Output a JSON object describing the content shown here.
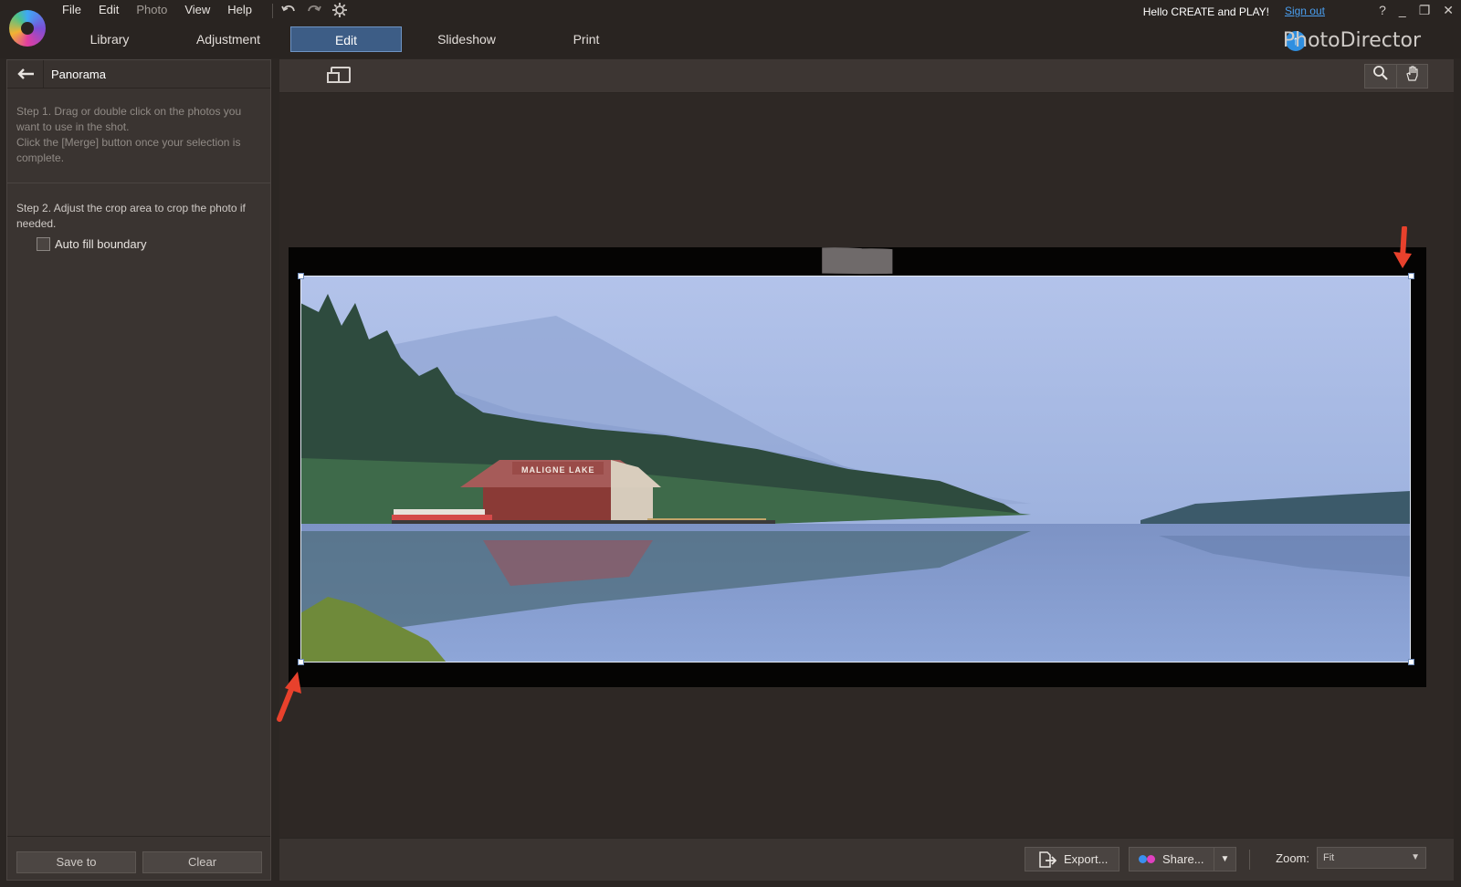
{
  "menu": {
    "items": [
      {
        "label": "File",
        "enabled": true
      },
      {
        "label": "Edit",
        "enabled": true
      },
      {
        "label": "Photo",
        "enabled": false
      },
      {
        "label": "View",
        "enabled": true
      },
      {
        "label": "Help",
        "enabled": true
      }
    ]
  },
  "toolbar_icons": [
    "undo-icon",
    "redo-icon",
    "settings-icon"
  ],
  "tabs": [
    {
      "label": "Library",
      "active": false
    },
    {
      "label": "Adjustment",
      "active": false
    },
    {
      "label": "Edit",
      "active": true
    },
    {
      "label": "Slideshow",
      "active": false
    },
    {
      "label": "Print",
      "active": false
    }
  ],
  "account": {
    "greeting": "Hello CREATE and PLAY!",
    "signout": "Sign out"
  },
  "window_controls": [
    "?",
    "_",
    "❐",
    "✕"
  ],
  "brand": {
    "name": "PhotoDirector",
    "badge_icon": "upgrade-arrow-icon"
  },
  "panel": {
    "title": "Panorama",
    "step1": "Step 1. Drag or double click on the photos you want to use in the shot.\nClick the [Merge] button once your selection is complete.",
    "step2": "Step 2. Adjust the crop area to crop the photo if needed.",
    "auto_fill_label": "Auto fill boundary",
    "auto_fill_checked": false,
    "save_label": "Save to",
    "clear_label": "Clear"
  },
  "viewer": {
    "photo_description": "Maligne Lake boat house panorama",
    "boathouse_sign": "MALIGNE LAKE"
  },
  "statusbar": {
    "export_label": "Export...",
    "share_label": "Share...",
    "zoom_label": "Zoom:",
    "zoom_value": "Fit"
  },
  "colors": {
    "accent": "#3d5d86",
    "link": "#4a9ff0",
    "arrow": "#e8412c"
  }
}
